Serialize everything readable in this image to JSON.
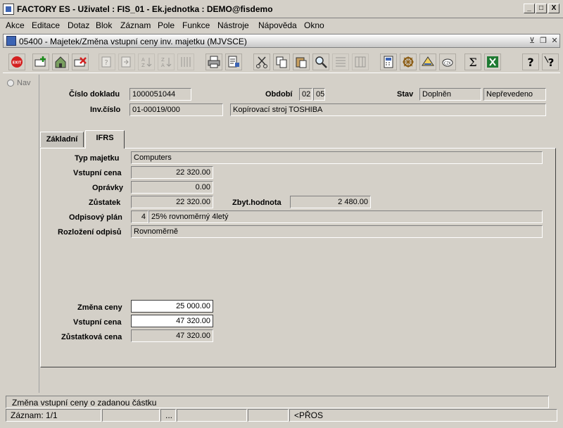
{
  "window": {
    "title": "FACTORY ES - Uživatel : FIS_01 - Ek.jednotka : DEMO@fisdemo",
    "minimize": "_",
    "maximize": "□",
    "close": "X"
  },
  "menu": [
    "Akce",
    "Editace",
    "Dotaz",
    "Blok",
    "Záznam",
    "Pole",
    "Funkce",
    "Nástroje",
    "Nápověda",
    "Okno"
  ],
  "form_window": {
    "title": "05400 - Majetek/Změna vstupní ceny inv. majetku (MJVSCE)"
  },
  "nav": {
    "label": "Nav"
  },
  "header": {
    "cislo_dokladu_label": "Číslo dokladu",
    "cislo_dokladu": "1000051044",
    "obdobi_label": "Období",
    "obdobi_mesic": "02",
    "obdobi_rok": "05",
    "stav_label": "Stav",
    "stav_1": "Doplněn",
    "stav_2": "Nepřevedeno",
    "inv_cislo_label": "Inv.číslo",
    "inv_cislo": "01-00019/000",
    "popis": "Kopírovací stroj TOSHIBA"
  },
  "tabs": [
    {
      "label": "Základní",
      "active": false
    },
    {
      "label": "IFRS",
      "active": true
    }
  ],
  "ifrs": {
    "typ_majetku_label": "Typ majetku",
    "typ_majetku": "Computers",
    "vstupni_cena_label": "Vstupní cena",
    "vstupni_cena": "22 320.00",
    "opravky_label": "Oprávky",
    "opravky": "0.00",
    "zustatek_label": "Zůstatek",
    "zustatek": "22 320.00",
    "zbyt_hodnota_label": "Zbyt.hodnota",
    "zbyt_hodnota": "2 480.00",
    "odpisovy_plan_label": "Odpisový plán",
    "odpisovy_plan_kod": "4",
    "odpisovy_plan": "25% rovnoměrný 4letý",
    "rozlozeni_label": "Rozložení odpisů",
    "rozlozeni": "Rovnoměrně",
    "zmena_ceny_label": "Změna ceny",
    "zmena_ceny": "25 000.00",
    "nova_vstupni_cena_label": "Vstupní cena",
    "nova_vstupni_cena": "47 320.00",
    "zustatkova_cena_label": "Zůstatková cena",
    "zustatkova_cena": "47 320.00"
  },
  "status": {
    "message": "Změna vstupní ceny o zadanou částku",
    "zaznam": "Záznam: 1/1",
    "cell_3": "...",
    "mode": "<PŘOS"
  },
  "toolbar_icons": [
    "exit-icon",
    "insert-record-icon",
    "save-icon",
    "delete-record-icon",
    "query-icon",
    "execute-query-icon",
    "sort-asc-icon",
    "sort-desc-icon",
    "sort-multi-icon",
    "print-icon",
    "print-preview-icon",
    "cut-icon",
    "copy-icon",
    "paste-icon",
    "find-icon",
    "list-icon",
    "columns-icon",
    "calculator-icon",
    "navigation-wheel-icon",
    "hierarchy-icon",
    "currency-icon",
    "history-icon",
    "sum-icon",
    "excel-icon",
    "help-icon",
    "context-help-icon"
  ],
  "colors": {
    "face": "#d4d0c8",
    "accent": "#3c64b4",
    "exit_red": "#d42020",
    "excel_green": "#1e7a32"
  }
}
